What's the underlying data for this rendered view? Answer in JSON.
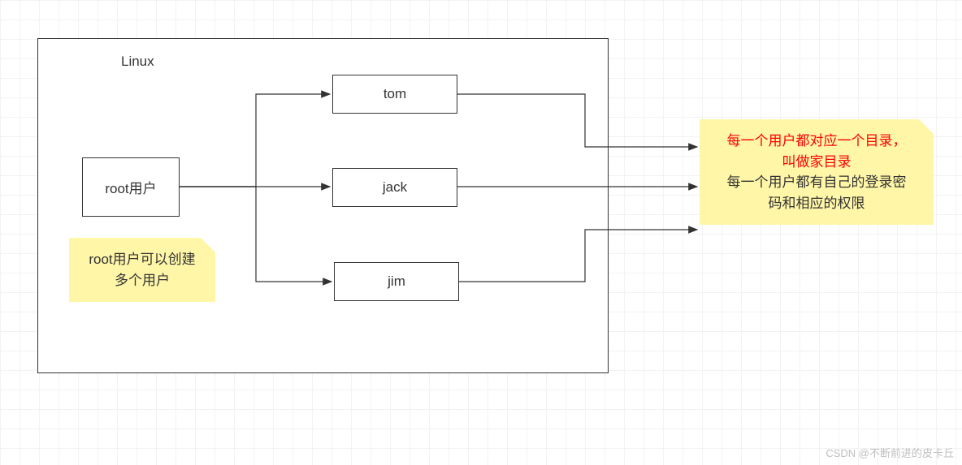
{
  "title": "Linux",
  "root_label": "root用户",
  "users": [
    "tom",
    "jack",
    "jim"
  ],
  "note_root": {
    "line1": "root用户可以创建",
    "line2": "多个用户"
  },
  "note_right": {
    "red1": "每一个用户都对应一个目录，",
    "red2": "叫做家目录",
    "black1": "每一个用户都有自己的登录密",
    "black2": "码和相应的权限"
  },
  "watermark": "CSDN @不断前进的皮卡丘",
  "colors": {
    "note_bg": "#fff6a8",
    "grid": "#f2f2f2",
    "border": "#333333",
    "red": "#ff0000"
  }
}
